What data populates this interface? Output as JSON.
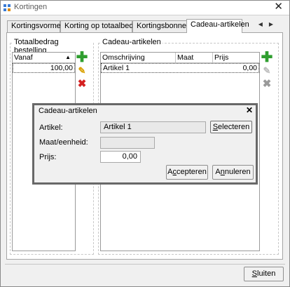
{
  "window": {
    "title": "Kortingen",
    "close_symbol": "✕"
  },
  "tabs": [
    {
      "label": "Kortingsvormen",
      "active": false
    },
    {
      "label": "Korting op totaalbedrag",
      "active": false
    },
    {
      "label": "Kortingsbonnen",
      "active": false
    },
    {
      "label": "Cadeau-artikelen",
      "active": true
    }
  ],
  "tab_nav": {
    "prev": "◀",
    "next": "▶"
  },
  "left_group": {
    "title": "Totaalbedrag bestelling",
    "column": "Vanaf",
    "sort_symbol": "▲",
    "rows": [
      {
        "vanaf": "100,00"
      }
    ]
  },
  "right_group": {
    "title": "Cadeau-artikelen",
    "columns": [
      "Omschrijving",
      "Maat",
      "Prijs"
    ],
    "rows": [
      {
        "omschrijving": "Artikel 1",
        "maat": "",
        "prijs": "0,00"
      }
    ]
  },
  "icons": {
    "add": "✚",
    "edit": "✎",
    "delete": "✖"
  },
  "dialog": {
    "title": "Cadeau-artikelen",
    "close_symbol": "✕",
    "artikel_label": "Artikel:",
    "artikel_value": "Artikel 1",
    "select_button": {
      "mnemonic": "S",
      "rest": "electeren"
    },
    "maat_label": "Maat/eenheid:",
    "maat_value": "",
    "prijs_label": "Prijs:",
    "prijs_value": "0,00",
    "accept_button": {
      "before": "A",
      "mnemonic": "c",
      "rest": "cepteren"
    },
    "cancel_button": {
      "before": "A",
      "mnemonic": "n",
      "rest": "nuleren"
    }
  },
  "close_button": {
    "mnemonic": "S",
    "rest": "luiten"
  },
  "colors": {
    "add_green": "#2f9e2f",
    "delete_red": "#d42020",
    "edit_yellow": "#d9a000"
  }
}
